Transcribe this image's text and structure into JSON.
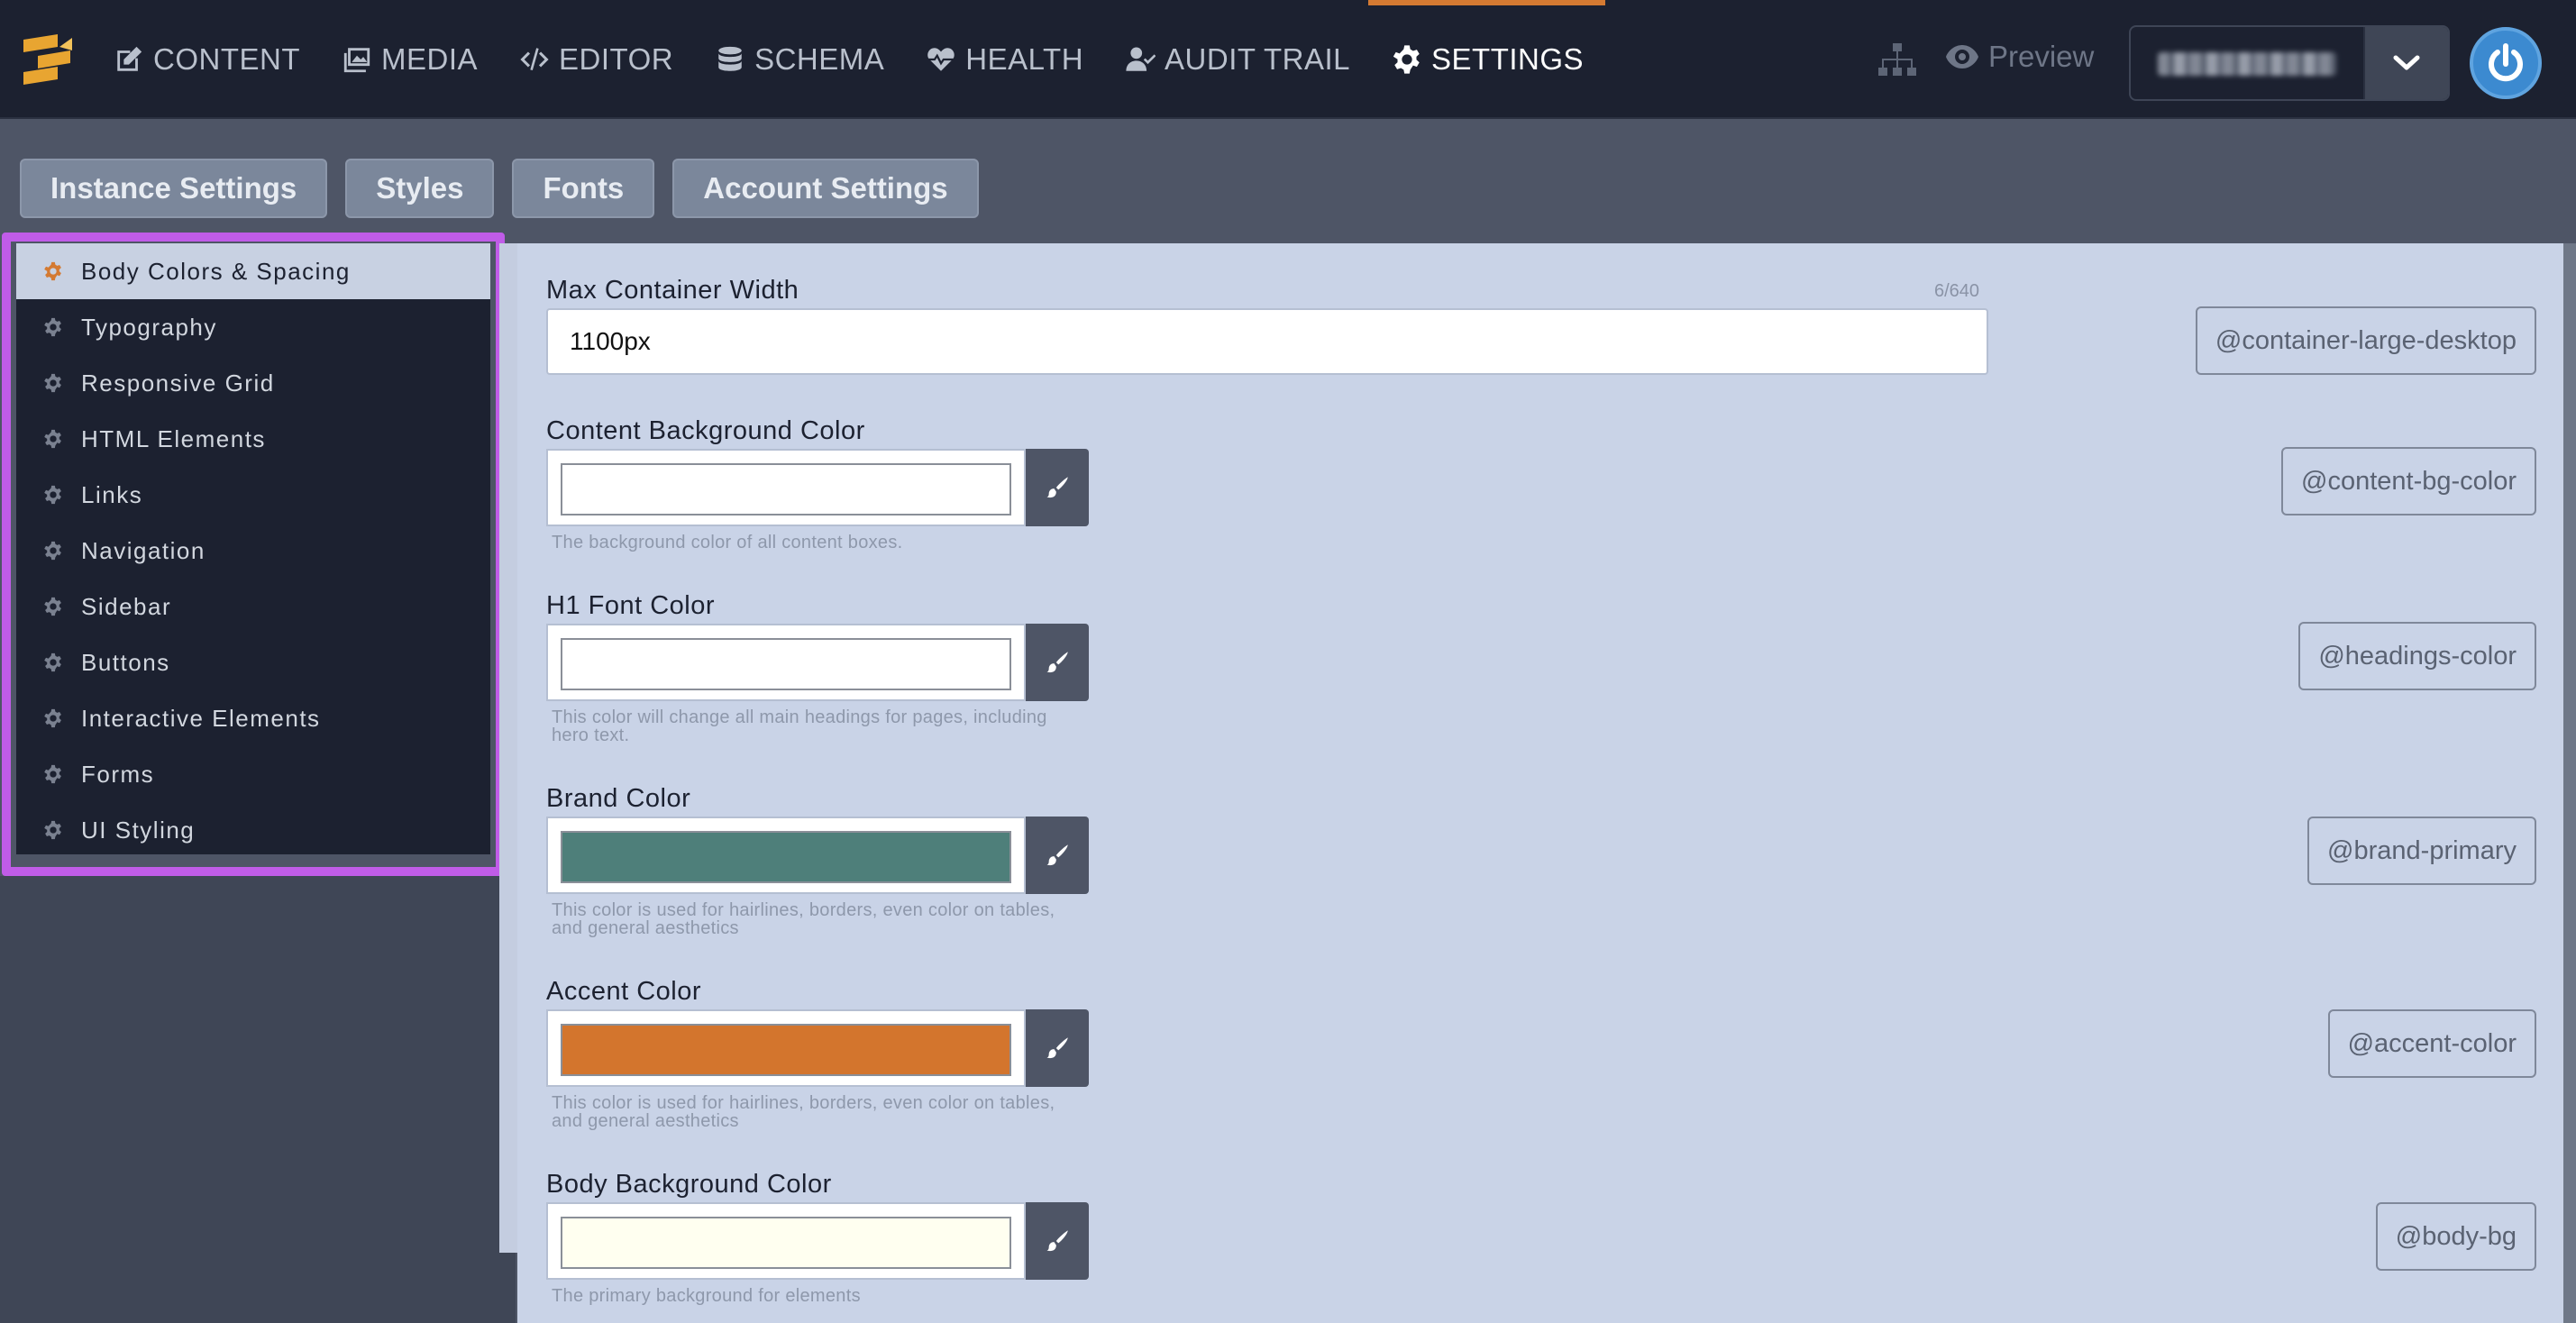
{
  "nav": {
    "items": [
      {
        "label": "CONTENT",
        "icon": "edit-icon"
      },
      {
        "label": "MEDIA",
        "icon": "images-icon"
      },
      {
        "label": "EDITOR",
        "icon": "code-icon"
      },
      {
        "label": "SCHEMA",
        "icon": "database-icon"
      },
      {
        "label": "HEALTH",
        "icon": "heartbeat-icon"
      },
      {
        "label": "AUDIT TRAIL",
        "icon": "user-check-icon"
      },
      {
        "label": "SETTINGS",
        "icon": "gear-icon",
        "active": true
      }
    ],
    "preview_label": "Preview",
    "instance_name": "",
    "active_accent": "#d47a32",
    "power_color": "#3c8ad0"
  },
  "subtabs": [
    "Instance Settings",
    "Styles",
    "Fonts",
    "Account Settings"
  ],
  "sidebar": {
    "items": [
      {
        "label": "Body Colors & Spacing",
        "active": true
      },
      {
        "label": "Typography"
      },
      {
        "label": "Responsive Grid"
      },
      {
        "label": "HTML Elements"
      },
      {
        "label": "Links"
      },
      {
        "label": "Navigation"
      },
      {
        "label": "Sidebar"
      },
      {
        "label": "Buttons"
      },
      {
        "label": "Interactive Elements"
      },
      {
        "label": "Forms"
      },
      {
        "label": "UI Styling"
      }
    ],
    "highlight_color": "#c05ce8"
  },
  "fields": {
    "max_width": {
      "label": "Max Container Width",
      "counter": "6/640",
      "value": "1100px",
      "variable": "@container-large-desktop"
    },
    "content_bg": {
      "label": "Content Background Color",
      "color": "#ffffff",
      "hint": "The background color of all content boxes.",
      "variable": "@content-bg-color"
    },
    "h1_color": {
      "label": "H1 Font Color",
      "color": "#ffffff",
      "hint": "This color will change all main headings for pages, including hero text.",
      "variable": "@headings-color"
    },
    "brand": {
      "label": "Brand Color",
      "color": "#4e7f7a",
      "hint": "This color is used for hairlines, borders, even color on tables, and general aesthetics",
      "variable": "@brand-primary"
    },
    "accent": {
      "label": "Accent Color",
      "color": "#d3752d",
      "hint": "This color is used for hairlines, borders, even color on tables, and general aesthetics",
      "variable": "@accent-color"
    },
    "body_bg": {
      "label": "Body Background Color",
      "color": "#fffff0",
      "hint": "The primary background for elements",
      "variable": "@body-bg"
    }
  }
}
